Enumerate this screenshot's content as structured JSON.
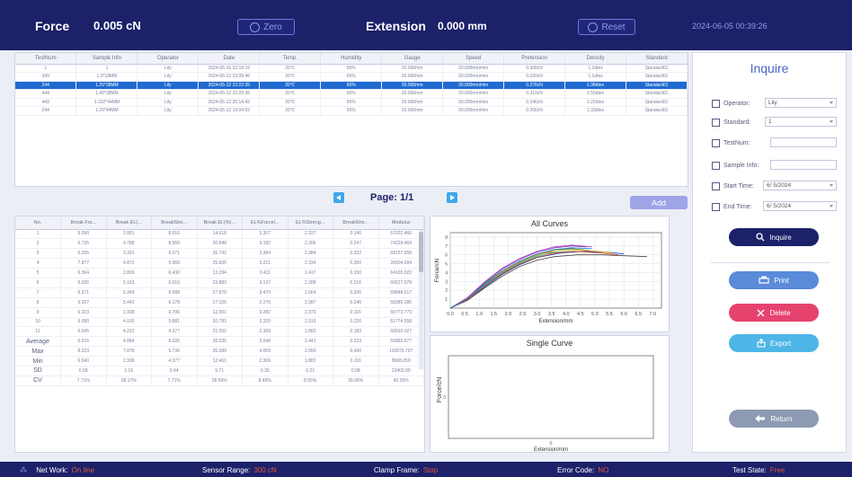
{
  "topbar": {
    "force_label": "Force",
    "force_value": "0.005 cN",
    "zero_label": "Zero",
    "extension_label": "Extension",
    "extension_value": "0.000 mm",
    "reset_label": "Reset",
    "datetime": "2024-06-05 00:39:26"
  },
  "test_table": {
    "columns": [
      "TestNum",
      "Sample Info",
      "Operator",
      "Date",
      "Temp.",
      "Humidity",
      "Gauge",
      "Speed",
      "Pretension",
      "Density",
      "Standard"
    ],
    "rows": [
      [
        "1",
        "1",
        "Lily",
        "2024-05-16 22:18:16",
        "20℃",
        "65%",
        "20.000mm",
        "20.000mm/min",
        "0.308cN",
        "1.1dtex",
        "Standard01"
      ],
      [
        "349",
        "1.0*18MM",
        "Lily",
        "2024-05-12 23:08:46",
        "20℃",
        "65%",
        "20.000mm",
        "20.000mm/min",
        "0.220cN",
        "1.1dtex",
        "Standard01"
      ],
      [
        "244",
        "1.25*38MM",
        "Lily",
        "2024-05-12 22:22:35",
        "20℃",
        "65%",
        "20.000mm",
        "20.000mm/min",
        "0.276cN",
        "1.38dtex",
        "Standard01"
      ],
      [
        "444",
        "1.40*38MM",
        "Lily",
        "2024-05-12 22:20:36",
        "20℃",
        "65%",
        "20.000mm",
        "20.000mm/min",
        "0.310cN",
        "1.55dtex",
        "Standard01"
      ],
      [
        "443",
        "1.102*44MM",
        "Lily",
        "2024-05-12 20:14:43",
        "20℃",
        "65%",
        "20.000mm",
        "20.000mm/min",
        "0.246cN",
        "1.22dtex",
        "Standard01"
      ],
      [
        "244",
        "1.20*44MM",
        "Lily",
        "2024-05-12 19:04:02",
        "20℃",
        "65%",
        "20.000mm",
        "20.000mm/min",
        "0.266cN",
        "1.33dtex",
        "Standard01"
      ]
    ],
    "selected_row": 2
  },
  "pager": {
    "text": "Page:  1/1",
    "add_label": "Add"
  },
  "results": {
    "columns": [
      "No.",
      "Break For...",
      "Break El.(...",
      "BreakStre...",
      "Break El.(%)...",
      "EL%Forcel...",
      "EL%Streng...",
      "BreakWor...",
      "Modulus"
    ],
    "rows": [
      [
        "1",
        "6.390",
        "2.881",
        "8.016",
        "14.618",
        "3.307",
        "2.327",
        "0.146",
        "67022.466"
      ],
      [
        "2",
        "6.735",
        "4.788",
        "8.560",
        "20.848",
        "3.182",
        "2.306",
        "0.247",
        "74229.464"
      ],
      [
        "3",
        "6.205",
        "3.391",
        "6.071",
        "26.742",
        "3.384",
        "2.384",
        "0.332",
        "68157.558"
      ],
      [
        "4",
        "7.877",
        "4.872",
        "5.960",
        "25.605",
        "3.221",
        "2.334",
        "0.260",
        "26004.994"
      ],
      [
        "5",
        "6.364",
        "2.809",
        "6.430",
        "13.294",
        "3.411",
        "2.417",
        "0.150",
        "64165.023"
      ],
      [
        "6",
        "6.026",
        "5.193",
        "6.016",
        "23.883",
        "3.137",
        "2.288",
        "0.216",
        "60027.078"
      ],
      [
        "7",
        "6.371",
        "5.349",
        "6.098",
        "27.870",
        "3.470",
        "2.564",
        "0.206",
        "58848.617"
      ],
      [
        "8",
        "6.327",
        "5.442",
        "6.178",
        "27.155",
        "2.270",
        "2.387",
        "0.246",
        "58380.286"
      ],
      [
        "9",
        "6.323",
        "2.308",
        "6.706",
        "12.301",
        "3.282",
        "2.379",
        "0.116",
        "50773.773"
      ],
      [
        "10",
        "6.080",
        "4.160",
        "5.881",
        "20.783",
        "3.320",
        "2.319",
        "0.226",
        "61774.558"
      ],
      [
        "11",
        "6.045",
        "4.222",
        "4.377",
        "21.052",
        "2.369",
        "1.882",
        "0.183",
        "66910.027"
      ]
    ],
    "stats": [
      [
        "Average",
        "6.516",
        "4.084",
        "6.026",
        "20.035",
        "3.048",
        "2.441",
        "0.223",
        "56882.977"
      ],
      [
        "Max",
        "8.323",
        "7.078",
        "6.736",
        "35.289",
        "4.059",
        "2.900",
        "0.430",
        "110075.797"
      ],
      [
        "Min",
        "6.040",
        "2.308",
        "4.377",
        "12.461",
        "2.369",
        "1.882",
        "0.116",
        "8668.059"
      ],
      [
        "SD",
        "0.58",
        "1.15",
        "0.44",
        "5.71",
        "0.35",
        "0.21",
        "0.08",
        "23402.09"
      ],
      [
        "CV",
        "7.71%",
        "28.17%",
        "7.71%",
        "28.56%",
        "8.45%",
        "8.05%",
        "36.06%",
        "40.05%"
      ]
    ]
  },
  "charts": {
    "all_curves_title": "All Curves",
    "single_curve_title": "Single Curve",
    "ylabel": "Force/cN",
    "xlabel": "Extension/mm",
    "single_x_tick": "0",
    "single_y_tick": "0"
  },
  "chart_data": [
    {
      "type": "line",
      "title": "All Curves",
      "xlabel": "Extension/mm",
      "ylabel": "Force/cN",
      "x_ticks": [
        "0.0",
        "0.5",
        "1.0",
        "1.5",
        "2.0",
        "2.5",
        "3.0",
        "3.5",
        "4.0",
        "4.5",
        "5.0",
        "5.5",
        "6.0",
        "6.5",
        "7.0"
      ],
      "y_ticks": [
        "1",
        "2",
        "3",
        "4",
        "5",
        "6",
        "7",
        "8"
      ],
      "xlim": [
        0,
        7.3
      ],
      "ylim": [
        0,
        8.5
      ],
      "series_colors": [
        "#e23a3a",
        "#2a8c2a",
        "#1f3bd1",
        "#c23fc2",
        "#2aa9c9",
        "#e6a21f",
        "#444444",
        "#7a3fc2",
        "#3fb56a",
        "#d1481f",
        "#1f7fd1"
      ],
      "series": [
        {
          "values": [
            [
              0,
              0
            ],
            [
              0.6,
              1
            ],
            [
              1.2,
              2.6
            ],
            [
              1.8,
              4.0
            ],
            [
              2.3,
              5.0
            ],
            [
              2.8,
              5.8
            ],
            [
              3.2,
              6.2
            ],
            [
              3.6,
              6.3
            ]
          ]
        },
        {
          "values": [
            [
              0,
              0
            ],
            [
              0.6,
              1.1
            ],
            [
              1.2,
              2.8
            ],
            [
              1.8,
              4.2
            ],
            [
              2.4,
              5.3
            ],
            [
              3.0,
              6.1
            ],
            [
              3.6,
              6.6
            ],
            [
              4.2,
              6.7
            ],
            [
              4.8,
              6.5
            ]
          ]
        },
        {
          "values": [
            [
              0,
              0
            ],
            [
              0.6,
              0.9
            ],
            [
              1.2,
              2.4
            ],
            [
              1.8,
              3.8
            ],
            [
              2.4,
              4.9
            ],
            [
              3.0,
              5.7
            ],
            [
              3.8,
              6.2
            ],
            [
              4.6,
              6.4
            ],
            [
              5.4,
              6.3
            ],
            [
              6.0,
              6.1
            ]
          ]
        },
        {
          "values": [
            [
              0,
              0
            ],
            [
              0.6,
              1.2
            ],
            [
              1.2,
              3.0
            ],
            [
              1.8,
              4.5
            ],
            [
              2.4,
              5.6
            ],
            [
              3.0,
              6.4
            ],
            [
              3.6,
              6.9
            ],
            [
              4.2,
              7.1
            ],
            [
              4.9,
              6.9
            ]
          ]
        },
        {
          "values": [
            [
              0,
              0
            ],
            [
              0.6,
              1.0
            ],
            [
              1.2,
              2.5
            ],
            [
              1.8,
              3.9
            ],
            [
              2.4,
              5.0
            ],
            [
              3.0,
              5.8
            ],
            [
              3.4,
              6.0
            ]
          ]
        },
        {
          "values": [
            [
              0,
              0
            ],
            [
              0.6,
              1.0
            ],
            [
              1.2,
              2.7
            ],
            [
              1.8,
              4.1
            ],
            [
              2.4,
              5.2
            ],
            [
              3.0,
              6.0
            ],
            [
              3.6,
              6.5
            ],
            [
              4.3,
              6.6
            ],
            [
              5.1,
              6.4
            ],
            [
              5.6,
              6.2
            ]
          ]
        },
        {
          "values": [
            [
              0,
              0
            ],
            [
              0.6,
              0.9
            ],
            [
              1.2,
              2.3
            ],
            [
              1.8,
              3.6
            ],
            [
              2.4,
              4.7
            ],
            [
              3.0,
              5.4
            ],
            [
              3.6,
              5.8
            ],
            [
              4.4,
              6.0
            ],
            [
              5.2,
              6.0
            ],
            [
              6.0,
              5.9
            ],
            [
              6.8,
              5.8
            ]
          ]
        },
        {
          "values": [
            [
              0,
              0
            ],
            [
              0.6,
              1.1
            ],
            [
              1.2,
              2.9
            ],
            [
              1.8,
              4.4
            ],
            [
              2.4,
              5.5
            ],
            [
              3.0,
              6.3
            ],
            [
              3.6,
              6.8
            ],
            [
              4.2,
              7.0
            ],
            [
              4.7,
              6.9
            ]
          ]
        },
        {
          "values": [
            [
              0,
              0
            ],
            [
              0.6,
              1.0
            ],
            [
              1.2,
              2.6
            ],
            [
              1.8,
              4.0
            ],
            [
              2.4,
              5.1
            ],
            [
              3.0,
              5.9
            ],
            [
              3.6,
              6.3
            ],
            [
              4.2,
              6.4
            ],
            [
              4.8,
              6.3
            ]
          ]
        },
        {
          "values": [
            [
              0,
              0
            ],
            [
              0.6,
              1.0
            ],
            [
              1.2,
              2.5
            ],
            [
              1.8,
              3.9
            ],
            [
              2.4,
              5.0
            ],
            [
              3.0,
              5.7
            ],
            [
              3.6,
              6.2
            ],
            [
              4.4,
              6.4
            ],
            [
              5.2,
              6.2
            ],
            [
              5.8,
              6.0
            ]
          ]
        },
        {
          "values": [
            [
              0,
              0
            ],
            [
              0.6,
              1.1
            ],
            [
              1.2,
              2.7
            ],
            [
              1.8,
              4.2
            ],
            [
              2.4,
              5.3
            ],
            [
              3.0,
              6.1
            ],
            [
              3.6,
              6.6
            ],
            [
              4.2,
              6.8
            ],
            [
              4.9,
              6.7
            ]
          ]
        }
      ]
    },
    {
      "type": "line",
      "title": "Single Curve",
      "xlabel": "Extension/mm",
      "ylabel": "Force/cN",
      "series": []
    }
  ],
  "inquire": {
    "title": "Inquire",
    "operator_label": "Operator:",
    "operator_value": "Lily",
    "standard_label": "Standard:",
    "standard_value": "1",
    "testnum_label": "TestNum:",
    "sample_info_label": "Sample Info:",
    "start_time_label": "Start Time:",
    "start_time_value": "6/ 5/2024",
    "end_time_label": "End Time:",
    "end_time_value": "6/ 5/2024",
    "inquire_btn": "Inquire",
    "print_btn": "Print",
    "delete_btn": "Delete",
    "export_btn": "Export",
    "return_btn": "Return"
  },
  "statusbar": {
    "network_label": "Net Work:",
    "network_value": "On line",
    "sensor_label": "Sensor Range:",
    "sensor_value": "300 cN",
    "clamp_label": "Clamp Frame:",
    "clamp_value": "Stop",
    "error_label": "Error Code:",
    "error_value": "NO",
    "state_label": "Test State:",
    "state_value": "Free"
  }
}
